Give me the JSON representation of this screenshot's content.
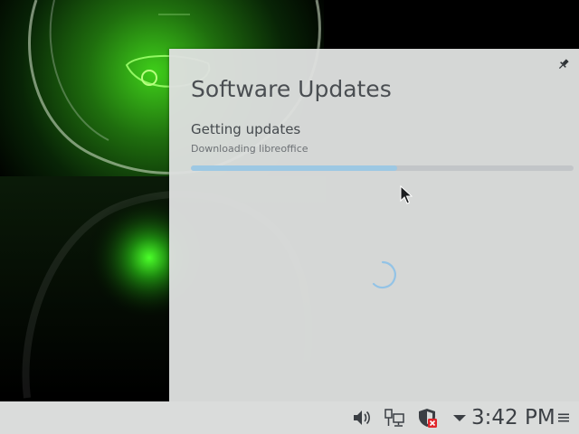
{
  "popup": {
    "title": "Software Updates",
    "status_heading": "Getting updates",
    "status_detail": "Downloading libreoffice",
    "progress_fraction": 0.54
  },
  "panel": {
    "clock": "3:42 PM",
    "icons": [
      "volume-icon",
      "network-wired-icon",
      "security-shield-error-icon",
      "tray-expand-arrow-icon",
      "panel-menu-icon"
    ]
  },
  "colors": {
    "accent": "#9dc8e3",
    "popup_bg": "#dee0df",
    "panel_bg": "#dadcdb",
    "alert_red": "#e0262b"
  }
}
